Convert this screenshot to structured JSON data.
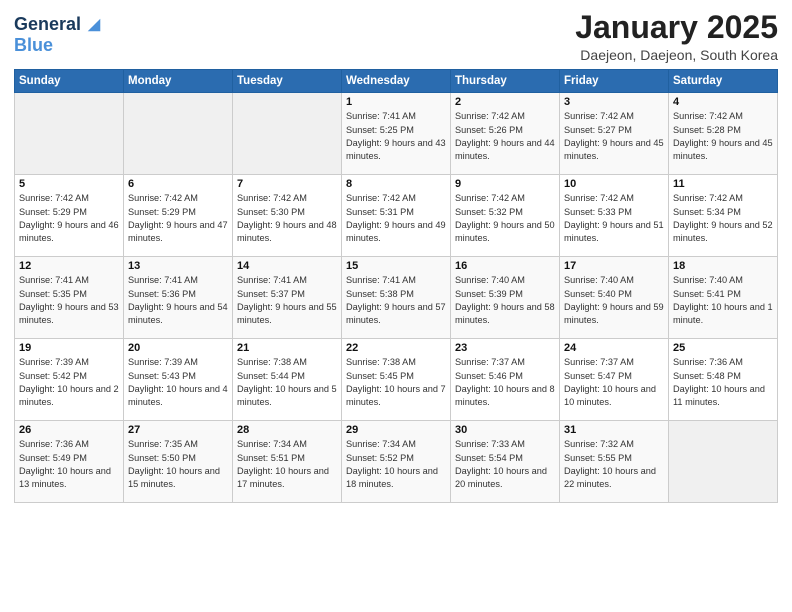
{
  "header": {
    "logo_line1": "General",
    "logo_line2": "Blue",
    "main_title": "January 2025",
    "subtitle": "Daejeon, Daejeon, South Korea"
  },
  "weekdays": [
    "Sunday",
    "Monday",
    "Tuesday",
    "Wednesday",
    "Thursday",
    "Friday",
    "Saturday"
  ],
  "weeks": [
    [
      {
        "day": "",
        "info": ""
      },
      {
        "day": "",
        "info": ""
      },
      {
        "day": "",
        "info": ""
      },
      {
        "day": "1",
        "info": "Sunrise: 7:41 AM\nSunset: 5:25 PM\nDaylight: 9 hours and 43 minutes."
      },
      {
        "day": "2",
        "info": "Sunrise: 7:42 AM\nSunset: 5:26 PM\nDaylight: 9 hours and 44 minutes."
      },
      {
        "day": "3",
        "info": "Sunrise: 7:42 AM\nSunset: 5:27 PM\nDaylight: 9 hours and 45 minutes."
      },
      {
        "day": "4",
        "info": "Sunrise: 7:42 AM\nSunset: 5:28 PM\nDaylight: 9 hours and 45 minutes."
      }
    ],
    [
      {
        "day": "5",
        "info": "Sunrise: 7:42 AM\nSunset: 5:29 PM\nDaylight: 9 hours and 46 minutes."
      },
      {
        "day": "6",
        "info": "Sunrise: 7:42 AM\nSunset: 5:29 PM\nDaylight: 9 hours and 47 minutes."
      },
      {
        "day": "7",
        "info": "Sunrise: 7:42 AM\nSunset: 5:30 PM\nDaylight: 9 hours and 48 minutes."
      },
      {
        "day": "8",
        "info": "Sunrise: 7:42 AM\nSunset: 5:31 PM\nDaylight: 9 hours and 49 minutes."
      },
      {
        "day": "9",
        "info": "Sunrise: 7:42 AM\nSunset: 5:32 PM\nDaylight: 9 hours and 50 minutes."
      },
      {
        "day": "10",
        "info": "Sunrise: 7:42 AM\nSunset: 5:33 PM\nDaylight: 9 hours and 51 minutes."
      },
      {
        "day": "11",
        "info": "Sunrise: 7:42 AM\nSunset: 5:34 PM\nDaylight: 9 hours and 52 minutes."
      }
    ],
    [
      {
        "day": "12",
        "info": "Sunrise: 7:41 AM\nSunset: 5:35 PM\nDaylight: 9 hours and 53 minutes."
      },
      {
        "day": "13",
        "info": "Sunrise: 7:41 AM\nSunset: 5:36 PM\nDaylight: 9 hours and 54 minutes."
      },
      {
        "day": "14",
        "info": "Sunrise: 7:41 AM\nSunset: 5:37 PM\nDaylight: 9 hours and 55 minutes."
      },
      {
        "day": "15",
        "info": "Sunrise: 7:41 AM\nSunset: 5:38 PM\nDaylight: 9 hours and 57 minutes."
      },
      {
        "day": "16",
        "info": "Sunrise: 7:40 AM\nSunset: 5:39 PM\nDaylight: 9 hours and 58 minutes."
      },
      {
        "day": "17",
        "info": "Sunrise: 7:40 AM\nSunset: 5:40 PM\nDaylight: 9 hours and 59 minutes."
      },
      {
        "day": "18",
        "info": "Sunrise: 7:40 AM\nSunset: 5:41 PM\nDaylight: 10 hours and 1 minute."
      }
    ],
    [
      {
        "day": "19",
        "info": "Sunrise: 7:39 AM\nSunset: 5:42 PM\nDaylight: 10 hours and 2 minutes."
      },
      {
        "day": "20",
        "info": "Sunrise: 7:39 AM\nSunset: 5:43 PM\nDaylight: 10 hours and 4 minutes."
      },
      {
        "day": "21",
        "info": "Sunrise: 7:38 AM\nSunset: 5:44 PM\nDaylight: 10 hours and 5 minutes."
      },
      {
        "day": "22",
        "info": "Sunrise: 7:38 AM\nSunset: 5:45 PM\nDaylight: 10 hours and 7 minutes."
      },
      {
        "day": "23",
        "info": "Sunrise: 7:37 AM\nSunset: 5:46 PM\nDaylight: 10 hours and 8 minutes."
      },
      {
        "day": "24",
        "info": "Sunrise: 7:37 AM\nSunset: 5:47 PM\nDaylight: 10 hours and 10 minutes."
      },
      {
        "day": "25",
        "info": "Sunrise: 7:36 AM\nSunset: 5:48 PM\nDaylight: 10 hours and 11 minutes."
      }
    ],
    [
      {
        "day": "26",
        "info": "Sunrise: 7:36 AM\nSunset: 5:49 PM\nDaylight: 10 hours and 13 minutes."
      },
      {
        "day": "27",
        "info": "Sunrise: 7:35 AM\nSunset: 5:50 PM\nDaylight: 10 hours and 15 minutes."
      },
      {
        "day": "28",
        "info": "Sunrise: 7:34 AM\nSunset: 5:51 PM\nDaylight: 10 hours and 17 minutes."
      },
      {
        "day": "29",
        "info": "Sunrise: 7:34 AM\nSunset: 5:52 PM\nDaylight: 10 hours and 18 minutes."
      },
      {
        "day": "30",
        "info": "Sunrise: 7:33 AM\nSunset: 5:54 PM\nDaylight: 10 hours and 20 minutes."
      },
      {
        "day": "31",
        "info": "Sunrise: 7:32 AM\nSunset: 5:55 PM\nDaylight: 10 hours and 22 minutes."
      },
      {
        "day": "",
        "info": ""
      }
    ]
  ]
}
